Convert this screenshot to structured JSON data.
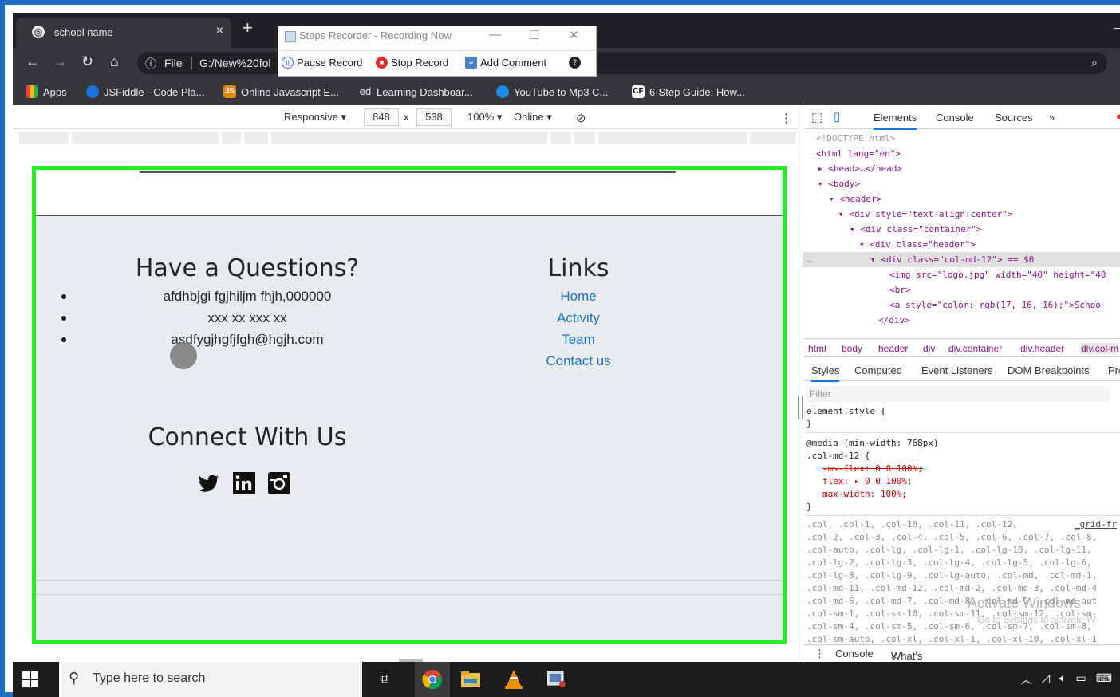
{
  "browser": {
    "tab_title": "school name",
    "tab_close": "×",
    "new_tab": "+",
    "url_file_label": "File",
    "url_text": "G:/New%20fol",
    "bookmarks": [
      {
        "label": "Apps"
      },
      {
        "label": "JSFiddle - Code Pla..."
      },
      {
        "label": "Online Javascript E..."
      },
      {
        "label": "Learning Dashboar..."
      },
      {
        "label": "YouTube to Mp3 C..."
      },
      {
        "label": "6-Step Guide: How..."
      }
    ],
    "bookmark_icons": [
      "JS",
      "ed",
      "CF"
    ]
  },
  "steps_recorder": {
    "title": "Steps Recorder - Recording Now",
    "pause_label": "Pause Record",
    "stop_label": "Stop Record",
    "comment_label": "Add Comment"
  },
  "device_toolbar": {
    "mode": "Responsive",
    "width": "848",
    "times": "x",
    "height": "538",
    "zoom": "100%",
    "network": "Online"
  },
  "page": {
    "questions_title": "Have a Questions?",
    "contacts": [
      "afdhbjgi fgjhiljm fhjh,000000",
      "xxx xx xxx xx",
      "asdfygjhgfjfgh@hgjh.com"
    ],
    "links_title": "Links",
    "links": [
      "Home",
      "Activity",
      "Team",
      "Contact us"
    ],
    "connect_title": "Connect With Us",
    "social": [
      "twitter-icon",
      "linkedin-icon",
      "instagram-icon"
    ]
  },
  "devtools": {
    "tabs": [
      "Elements",
      "Console",
      "Sources",
      "»"
    ],
    "dom": {
      "doctype": "<!DOCTYPE html>",
      "html_open": "<html lang=\"en\">",
      "head": "<head>…</head>",
      "body": "<body>",
      "header": "<header>",
      "div_center": "<div style=\"text-align:center\">",
      "div_container": "<div class=\"container\">",
      "div_header": "<div class=\"header\">",
      "div_col": "<div class=\"col-md-12\"> == $0",
      "img": "<img src=\"logo.jpg\" width=\"40\" height=\"40",
      "br": "<br>",
      "a": "<a style=\"color: rgb(17, 16, 16);\">Schoo",
      "div_close": "</div>"
    },
    "breadcrumbs": [
      "html",
      "body",
      "header",
      "div",
      "div.container",
      "div.header",
      "div.col-m"
    ],
    "style_tabs": [
      "Styles",
      "Computed",
      "Event Listeners",
      "DOM Breakpoints",
      "Pro"
    ],
    "filter_placeholder": "Filter",
    "css_lines": {
      "element_style": "element.style {",
      "close": "}",
      "media": "@media (min-width: 768px)",
      "col_sel": ".col-md-12 {",
      "ms_flex": "-ms-flex: 0 0 100%;",
      "flex": "flex: ▸ 0 0 100%;",
      "max_width": "max-width: 100%;",
      "grid_link": "_grid-fr",
      "list": [
        ".col, .col-1, .col-10, .col-11, .col-12,",
        ".col-2, .col-3, .col-4, .col-5, .col-6, .col-7, .col-8,",
        ".col-auto, .col-lg, .col-lg-1, .col-lg-10, .col-lg-11,",
        ".col-lg-2, .col-lg-3, .col-lg-4, .col-lg-5, .col-lg-6,",
        ".col-lg-8, .col-lg-9, .col-lg-auto, .col-md, .col-md-1,",
        ".col-md-11, .col-md-12, .col-md-2, .col-md-3, .col-md-4",
        ".col-md-6, .col-md-7, .col-md-8, .col-md-9, .col-md-aut",
        ".col-sm-1, .col-sm-10, .col-sm-11, .col-sm-12, .col-sm-",
        ".col-sm-4, .col-sm-5, .col-sm-6, .col-sm-7, .col-sm-8,",
        ".col-sm-auto, .col-xl, .col-xl-1, .col-xl-10, .col-xl-1"
      ]
    },
    "watermark": "Activate Windows",
    "watermark_sub": "Go to Settings to activate W",
    "drawer": [
      "Console",
      "What's New"
    ],
    "drawer_close": "×"
  },
  "taskbar": {
    "search_placeholder": "Type here to search"
  }
}
